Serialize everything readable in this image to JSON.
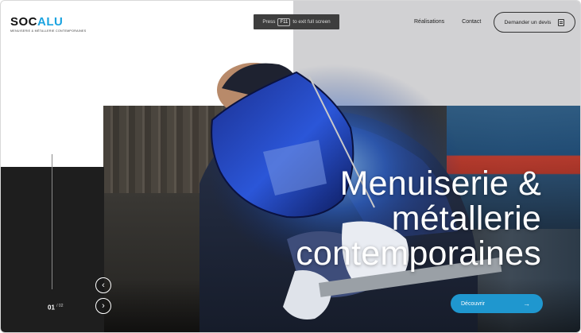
{
  "brand": {
    "name_part1": "SOC",
    "name_part2": "ALU",
    "tagline": "MENUISERIE & MÉTALLERIE CONTEMPORAINES"
  },
  "fullscreen_hint": {
    "prefix": "Press",
    "key": "F11",
    "suffix": "to exit full screen"
  },
  "nav": {
    "items": [
      "Réalisations",
      "Contact"
    ]
  },
  "quote_button": {
    "label": "Demander un devis",
    "icon": "document-edit-icon"
  },
  "hero": {
    "headline_lines": [
      "Menuiserie &",
      "métallerie",
      "contemporaines"
    ],
    "cta_label": "Découvrir",
    "cta_icon": "arrow-right-icon"
  },
  "slider": {
    "current": "01",
    "separator": "/",
    "total": "02",
    "prev_icon": "chevron-left-icon",
    "next_icon": "chevron-right-icon"
  },
  "colors": {
    "accent": "#1aa3e0",
    "cta": "#1f97cf",
    "dark_panel": "#1e1e1e",
    "gray_panel": "#d1d1d3"
  }
}
